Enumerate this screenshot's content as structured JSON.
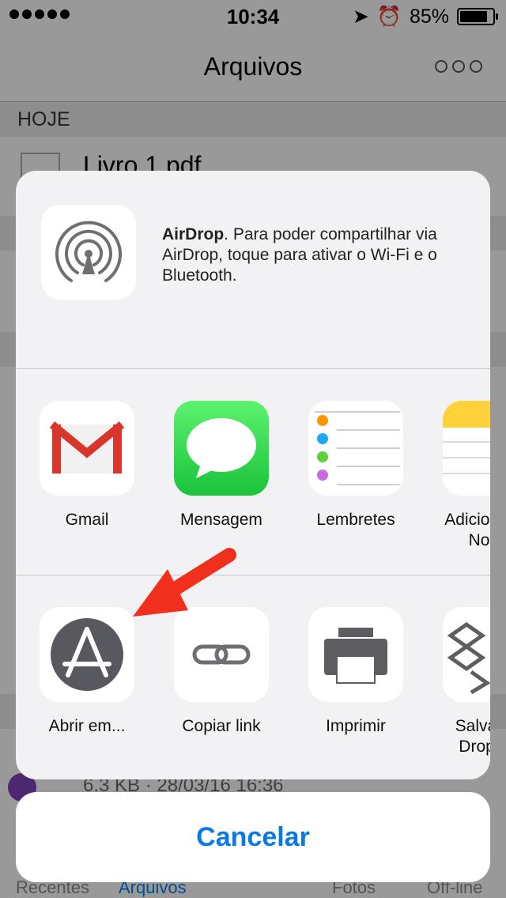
{
  "status_bar": {
    "time": "10:34",
    "battery": "85%",
    "battery_level": 0.85
  },
  "app": {
    "nav_title": "Arquivos",
    "section_header": "HOJE",
    "file_name": "Livro 1.pdf",
    "file_meta": "6.3 KB · 28/03/16 16:36",
    "tabs": [
      "Recentes",
      "Arquivos",
      "Fotos",
      "Off-line"
    ]
  },
  "share_sheet": {
    "airdrop_title": "AirDrop",
    "airdrop_text": ". Para poder compartilhar via AirDrop, toque para ativar o Wi-Fi e o Bluetooth.",
    "apps": [
      {
        "label": "Gmail"
      },
      {
        "label": "Mensagem"
      },
      {
        "label": "Lembretes"
      },
      {
        "label": "Adicionar às Notas"
      }
    ],
    "actions": [
      {
        "label": "Abrir em..."
      },
      {
        "label": "Copiar link"
      },
      {
        "label": "Imprimir"
      },
      {
        "label": "Salvar no Dropbox"
      }
    ],
    "cancel_label": "Cancelar"
  },
  "colors": {
    "accent": "#0a7ae0",
    "arrow": "#f0301c"
  }
}
